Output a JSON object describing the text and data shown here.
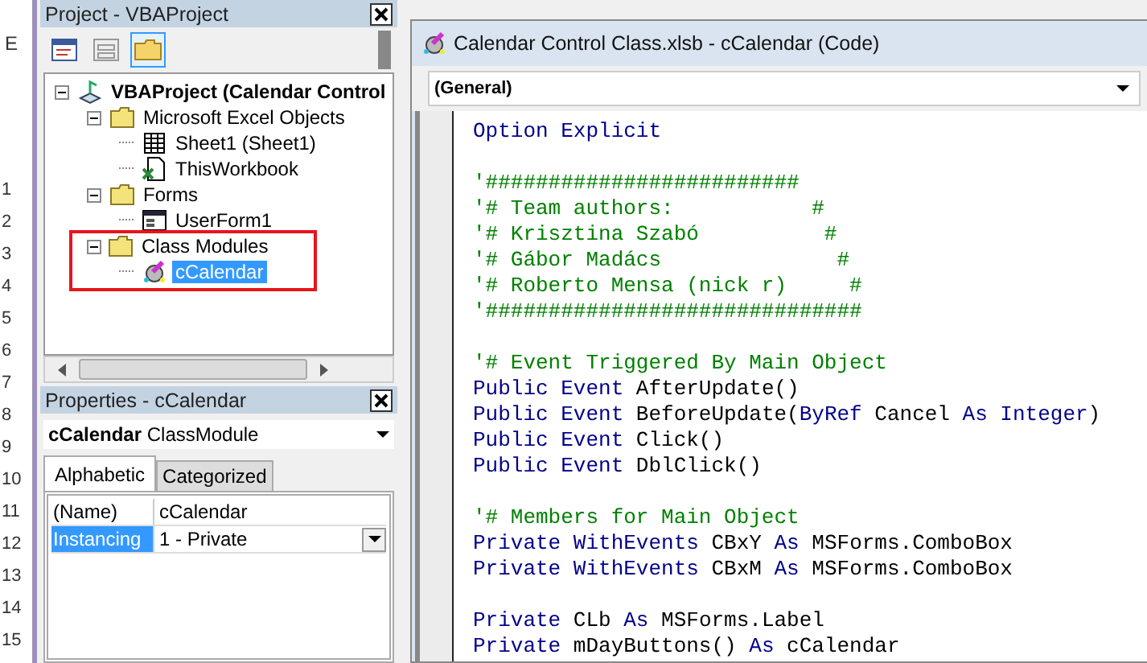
{
  "sheet": {
    "column_header": "E",
    "row_numbers": [
      "1",
      "2",
      "3",
      "4",
      "5",
      "6",
      "7",
      "8",
      "9",
      "10",
      "11",
      "12",
      "13",
      "14",
      "15"
    ]
  },
  "project": {
    "title": "Project - VBAProject",
    "toolbar": [
      {
        "kind": "view-code",
        "selected": false
      },
      {
        "kind": "view-object",
        "selected": false
      },
      {
        "kind": "toggle-folders",
        "selected": true
      }
    ],
    "tree": [
      {
        "label": "VBAProject (Calendar Control",
        "kind": "project",
        "expanded": true,
        "selected": false,
        "highlighted": false,
        "children": [
          {
            "label": "Microsoft Excel Objects",
            "kind": "folder",
            "expanded": true,
            "selected": false,
            "highlighted": false,
            "children": [
              {
                "label": "Sheet1 (Sheet1)",
                "kind": "sheet",
                "selected": false,
                "highlighted": false
              },
              {
                "label": "ThisWorkbook",
                "kind": "workbook",
                "selected": false,
                "highlighted": false
              }
            ]
          },
          {
            "label": "Forms",
            "kind": "folder",
            "expanded": true,
            "selected": false,
            "highlighted": false,
            "children": [
              {
                "label": "UserForm1",
                "kind": "form",
                "selected": false,
                "highlighted": false
              }
            ]
          },
          {
            "label": "Class Modules",
            "kind": "folder",
            "expanded": true,
            "selected": false,
            "highlighted": true,
            "children": [
              {
                "label": "cCalendar",
                "kind": "class",
                "selected": true,
                "highlighted": false
              }
            ]
          }
        ]
      }
    ]
  },
  "properties": {
    "title": "Properties - cCalendar",
    "object": "**cCalendar** ClassModule",
    "tabs": [
      {
        "label": "Alphabetic",
        "selected": true
      },
      {
        "label": "Categorized",
        "selected": false
      }
    ],
    "rows": [
      {
        "name": "(Name)",
        "value": "cCalendar",
        "selected": false,
        "dropdown": false
      },
      {
        "name": "Instancing",
        "value": "1 - Private",
        "selected": true,
        "dropdown": true
      }
    ]
  },
  "code_window": {
    "title": "Calendar Control Class.xlsb - cCalendar (Code)",
    "object": "(General)",
    "lines": [
      {
        "kind": "code",
        "segments": [
          {
            "kind": "keyword",
            "text": "Option Explicit"
          }
        ]
      },
      {
        "kind": "blank"
      },
      {
        "kind": "code",
        "segments": [
          {
            "kind": "comment",
            "text": "'#########################"
          }
        ]
      },
      {
        "kind": "code",
        "segments": [
          {
            "kind": "comment",
            "text": "'# Team authors:           #"
          }
        ]
      },
      {
        "kind": "code",
        "segments": [
          {
            "kind": "comment",
            "text": "'# Krisztina Szabó          #"
          }
        ]
      },
      {
        "kind": "code",
        "segments": [
          {
            "kind": "comment",
            "text": "'# Gábor Madács              #"
          }
        ]
      },
      {
        "kind": "code",
        "segments": [
          {
            "kind": "comment",
            "text": "'# Roberto Mensa (nick r)     #"
          }
        ]
      },
      {
        "kind": "code",
        "segments": [
          {
            "kind": "comment",
            "text": "'##############################"
          }
        ]
      },
      {
        "kind": "blank"
      },
      {
        "kind": "code",
        "segments": [
          {
            "kind": "comment",
            "text": "'# Event Triggered By Main Object"
          }
        ]
      },
      {
        "kind": "code",
        "segments": [
          {
            "kind": "keyword",
            "text": "Public Event"
          },
          {
            "kind": "text",
            "text": " AfterUpdate()"
          }
        ]
      },
      {
        "kind": "code",
        "segments": [
          {
            "kind": "keyword",
            "text": "Public Event"
          },
          {
            "kind": "text",
            "text": " BeforeUpdate("
          },
          {
            "kind": "keyword",
            "text": "ByRef"
          },
          {
            "kind": "text",
            "text": " Cancel "
          },
          {
            "kind": "keyword",
            "text": "As Integer"
          },
          {
            "kind": "text",
            "text": ")"
          }
        ]
      },
      {
        "kind": "code",
        "segments": [
          {
            "kind": "keyword",
            "text": "Public Event"
          },
          {
            "kind": "text",
            "text": " Click()"
          }
        ]
      },
      {
        "kind": "code",
        "segments": [
          {
            "kind": "keyword",
            "text": "Public Event"
          },
          {
            "kind": "text",
            "text": " DblClick()"
          }
        ]
      },
      {
        "kind": "blank"
      },
      {
        "kind": "code",
        "segments": [
          {
            "kind": "comment",
            "text": "'# Members for Main Object"
          }
        ]
      },
      {
        "kind": "code",
        "segments": [
          {
            "kind": "keyword",
            "text": "Private WithEvents"
          },
          {
            "kind": "text",
            "text": " CBxY "
          },
          {
            "kind": "keyword",
            "text": "As"
          },
          {
            "kind": "text",
            "text": " MSForms.ComboBox"
          }
        ]
      },
      {
        "kind": "code",
        "segments": [
          {
            "kind": "keyword",
            "text": "Private WithEvents"
          },
          {
            "kind": "text",
            "text": " CBxM "
          },
          {
            "kind": "keyword",
            "text": "As"
          },
          {
            "kind": "text",
            "text": " MSForms.ComboBox"
          }
        ]
      },
      {
        "kind": "blank"
      },
      {
        "kind": "code",
        "segments": [
          {
            "kind": "keyword",
            "text": "Private"
          },
          {
            "kind": "text",
            "text": " CLb "
          },
          {
            "kind": "keyword",
            "text": "As"
          },
          {
            "kind": "text",
            "text": " MSForms.Label"
          }
        ]
      },
      {
        "kind": "code",
        "segments": [
          {
            "kind": "keyword",
            "text": "Private"
          },
          {
            "kind": "text",
            "text": " mDayButtons() "
          },
          {
            "kind": "keyword",
            "text": "As"
          },
          {
            "kind": "text",
            "text": " cCalendar"
          }
        ]
      }
    ]
  }
}
